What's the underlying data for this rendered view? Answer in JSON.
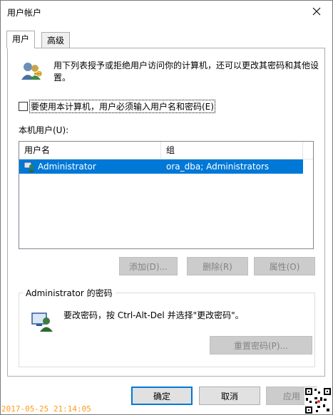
{
  "window": {
    "title": "用户帐户"
  },
  "tabs": [
    {
      "label": "用户",
      "active": true
    },
    {
      "label": "高级",
      "active": false
    }
  ],
  "intro": {
    "text": "用下列表授予或拒绝用户访问你的计算机，还可以更改其密码和其他设置。"
  },
  "checkbox": {
    "label": "要使用本计算机，用户必须输入用户名和密码(E)",
    "checked": false
  },
  "users": {
    "label": "本机用户(U):",
    "columns": [
      "用户名",
      "组"
    ],
    "rows": [
      {
        "name": "Administrator",
        "group": "ora_dba; Administrators",
        "selected": true
      }
    ]
  },
  "buttons": {
    "add": "添加(D)...",
    "remove": "删除(R)",
    "properties": "属性(O)"
  },
  "password_group": {
    "legend": "Administrator 的密码",
    "text": "要改密码，按 Ctrl-Alt-Del 并选择\"更改密码\"。",
    "reset_button": "重置密码(P)..."
  },
  "footer": {
    "ok": "确定",
    "cancel": "取消",
    "apply": "应用"
  },
  "overlay": {
    "timestamp": "2017-05-25 21:14:05"
  },
  "colors": {
    "selection": "#0078d7",
    "timestamp": "#ff9a1a"
  }
}
